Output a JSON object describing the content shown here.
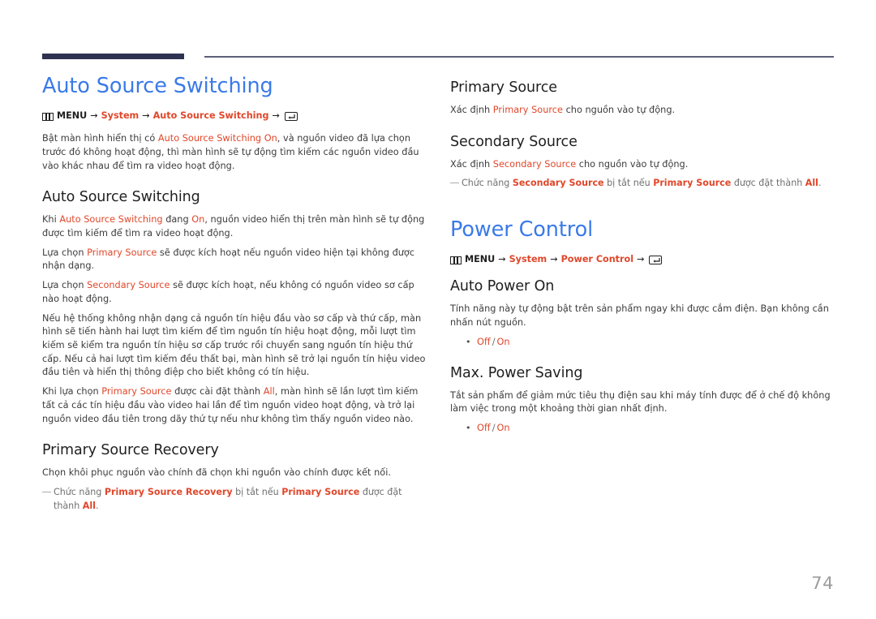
{
  "document": {
    "page_number": "74",
    "accent_blue": "#3a7ae8",
    "accent_orange": "#e0472b",
    "rule_navy": "#2e3352"
  },
  "left_column": {
    "chapter_title": "Auto Source Switching",
    "menu_path": {
      "menu_label": "MENU",
      "arrow": "→",
      "step1": "System",
      "step2": "Auto Source Switching",
      "menu_icon": "menu-grid-icon",
      "enter_icon": "enter-key-icon"
    },
    "intro": {
      "p1_a": "Bật màn hình hiển thị có ",
      "p1_hl": "Auto Source Switching On",
      "p1_b": ", và nguồn video đã lựa chọn trước đó không hoạt động, thì màn hình sẽ tự động tìm kiếm các nguồn video đầu vào khác nhau để tìm ra video hoạt động."
    },
    "section1": {
      "heading": "Auto Source Switching",
      "p1_a": "Khi ",
      "p1_hl1": "Auto Source Switching",
      "p1_b": " đang ",
      "p1_hl2": "On",
      "p1_c": ", nguồn video hiển thị trên màn hình sẽ tự động được tìm kiếm để tìm ra video hoạt động.",
      "p2_a": "Lựa chọn ",
      "p2_hl": "Primary Source",
      "p2_b": " sẽ được kích hoạt nếu nguồn video hiện tại không được nhận dạng.",
      "p3_a": "Lựa chọn ",
      "p3_hl": "Secondary Source",
      "p3_b": " sẽ được kích hoạt, nếu không có nguồn video sơ cấp nào hoạt động.",
      "p4": "Nếu hệ thống không nhận dạng cả nguồn tín hiệu đầu vào sơ cấp và thứ cấp, màn hình sẽ tiến hành hai lượt tìm kiếm để tìm nguồn tín hiệu hoạt động, mỗi lượt tìm kiếm sẽ kiểm tra nguồn tín hiệu sơ cấp trước rồi chuyển sang nguồn tín hiệu thứ cấp. Nếu cả hai lượt tìm kiếm đều thất bại, màn hình sẽ trở lại nguồn tín hiệu video đầu tiên và hiển thị thông điệp cho biết không có tín hiệu.",
      "p5_a": "Khi lựa chọn ",
      "p5_hl1": "Primary Source",
      "p5_b": " được cài đặt thành ",
      "p5_hl2": "All",
      "p5_c": ", màn hình sẽ lần lượt tìm kiếm tất cả các tín hiệu đầu vào video hai lần để tìm nguồn video hoạt động, và trở lại nguồn video đầu tiên trong dãy thứ tự nếu như không tìm thấy nguồn video nào."
    },
    "section2": {
      "heading": "Primary Source Recovery",
      "p1": "Chọn khôi phục nguồn vào chính đã chọn khi nguồn vào chính được kết nối.",
      "note_dash": "―",
      "note_a": "Chức năng ",
      "note_hl1": "Primary Source Recovery",
      "note_b": " bị tắt nếu ",
      "note_hl2": "Primary Source",
      "note_c": " được đặt thành ",
      "note_hl3": "All",
      "note_d": "."
    }
  },
  "right_column": {
    "section1": {
      "heading": "Primary Source",
      "p1_a": "Xác định ",
      "p1_hl": "Primary Source",
      "p1_b": " cho nguồn vào tự động."
    },
    "section2": {
      "heading": "Secondary Source",
      "p1_a": "Xác định ",
      "p1_hl": "Secondary Source",
      "p1_b": " cho nguồn vào tự động.",
      "note_dash": "―",
      "note_a": "Chức năng ",
      "note_hl1": "Secondary Source",
      "note_b": " bị tắt nếu ",
      "note_hl2": "Primary Source",
      "note_c": " được đặt thành ",
      "note_hl3": "All",
      "note_d": "."
    },
    "chapter_title": "Power Control",
    "menu_path": {
      "menu_label": "MENU",
      "arrow": "→",
      "step1": "System",
      "step2": "Power Control",
      "menu_icon": "menu-grid-icon",
      "enter_icon": "enter-key-icon"
    },
    "section3": {
      "heading": "Auto Power On",
      "p1": "Tính năng này tự động bật trên sản phẩm ngay khi được cắm điện. Bạn không cần nhấn nút nguồn.",
      "bullet": "•",
      "opt_off": "Off",
      "opt_sep": "/",
      "opt_on": "On"
    },
    "section4": {
      "heading": "Max. Power Saving",
      "p1": "Tắt sản phẩm để giảm mức tiêu thụ điện sau khi máy tính được để ở chế độ không làm việc trong một khoảng thời gian nhất định.",
      "bullet": "•",
      "opt_off": "Off",
      "opt_sep": "/",
      "opt_on": "On"
    }
  }
}
